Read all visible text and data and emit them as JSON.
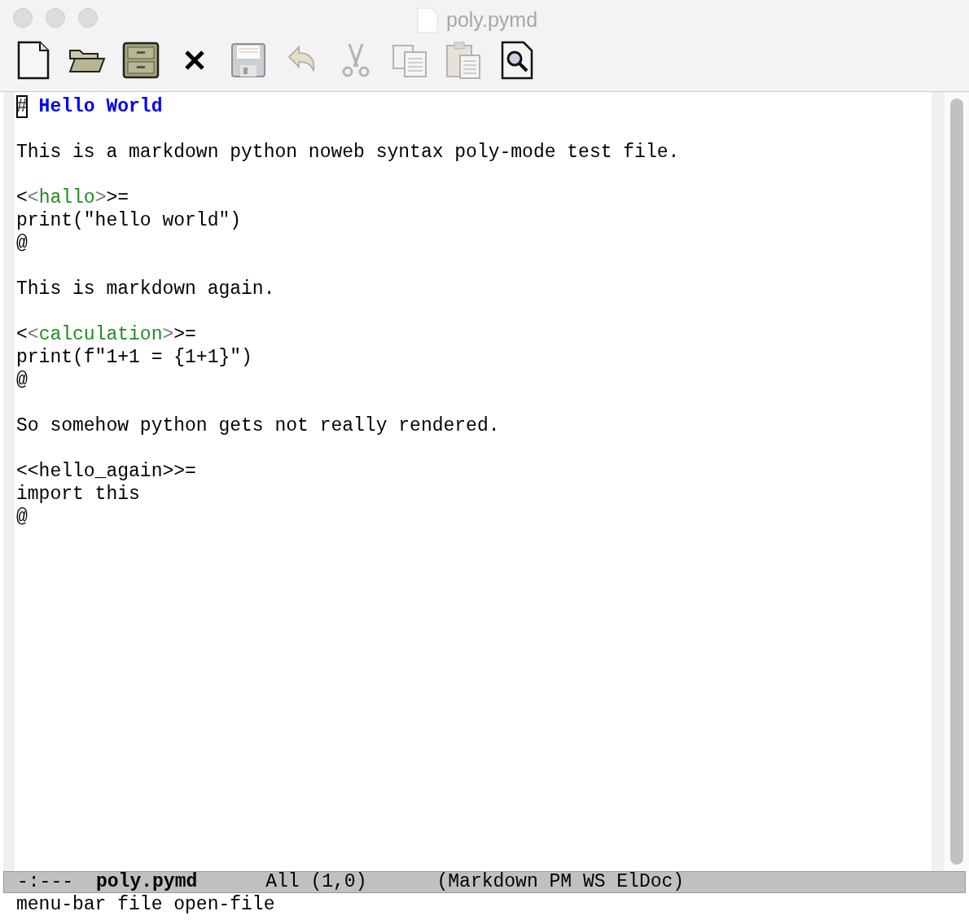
{
  "window": {
    "title": "poly.pymd"
  },
  "toolbar": [
    {
      "kind": "new",
      "disabled": false
    },
    {
      "kind": "open",
      "disabled": false
    },
    {
      "kind": "cabinet",
      "disabled": false
    },
    {
      "kind": "close",
      "disabled": false
    },
    {
      "kind": "save",
      "disabled": true
    },
    {
      "kind": "undo",
      "disabled": true
    },
    {
      "kind": "cut",
      "disabled": true
    },
    {
      "kind": "copy",
      "disabled": true
    },
    {
      "kind": "paste",
      "disabled": true
    },
    {
      "kind": "search",
      "disabled": false
    }
  ],
  "buffer": [
    {
      "lines": [
        {
          "segments": [
            {
              "kind": "heading-mark",
              "text": "#",
              "cursor": true
            },
            {
              "kind": "heading",
              "text": "Hello World",
              "cursor": false
            }
          ]
        }
      ]
    },
    {
      "lines": [
        {
          "segments": [
            {
              "kind": "plain",
              "text": "This is a markdown python noweb syntax poly-mode test file.",
              "cursor": false
            }
          ]
        }
      ]
    },
    {
      "lines": [
        {
          "segments": [
            {
              "kind": "plain",
              "text": "<",
              "cursor": false
            },
            {
              "kind": "bracket",
              "text": "<",
              "cursor": false
            },
            {
              "kind": "chunk-name",
              "text": "hallo",
              "cursor": false
            },
            {
              "kind": "bracket",
              "text": ">",
              "cursor": false
            },
            {
              "kind": "plain",
              "text": ">=",
              "cursor": false
            }
          ]
        },
        {
          "segments": [
            {
              "kind": "plain",
              "text": "print(\"hello world\")",
              "cursor": false
            }
          ]
        },
        {
          "segments": [
            {
              "kind": "plain",
              "text": "@",
              "cursor": false
            }
          ]
        }
      ]
    },
    {
      "lines": [
        {
          "segments": [
            {
              "kind": "plain",
              "text": "This is markdown again.",
              "cursor": false
            }
          ]
        }
      ]
    },
    {
      "lines": [
        {
          "segments": [
            {
              "kind": "plain",
              "text": "<",
              "cursor": false
            },
            {
              "kind": "bracket",
              "text": "<",
              "cursor": false
            },
            {
              "kind": "chunk-name",
              "text": "calculation",
              "cursor": false
            },
            {
              "kind": "bracket",
              "text": ">",
              "cursor": false
            },
            {
              "kind": "plain",
              "text": ">=",
              "cursor": false
            }
          ]
        },
        {
          "segments": [
            {
              "kind": "plain",
              "text": "print(f\"1+1 = {1+1}\")",
              "cursor": false
            }
          ]
        },
        {
          "segments": [
            {
              "kind": "plain",
              "text": "@",
              "cursor": false
            }
          ]
        }
      ]
    },
    {
      "lines": [
        {
          "segments": [
            {
              "kind": "plain",
              "text": "So somehow python gets not really rendered.",
              "cursor": false
            }
          ]
        }
      ]
    },
    {
      "lines": [
        {
          "segments": [
            {
              "kind": "plain",
              "text": "<<hello_again>>=",
              "cursor": false
            }
          ]
        },
        {
          "segments": [
            {
              "kind": "plain",
              "text": "import this",
              "cursor": false
            }
          ]
        },
        {
          "segments": [
            {
              "kind": "plain",
              "text": "@",
              "cursor": false
            }
          ]
        }
      ]
    }
  ],
  "mode_line": {
    "status": "-:---",
    "buffer_name": "poly.pymd",
    "position": "All (1,0)",
    "modes": "(Markdown PM WS ElDoc)"
  },
  "echo_area": "menu-bar file open-file"
}
